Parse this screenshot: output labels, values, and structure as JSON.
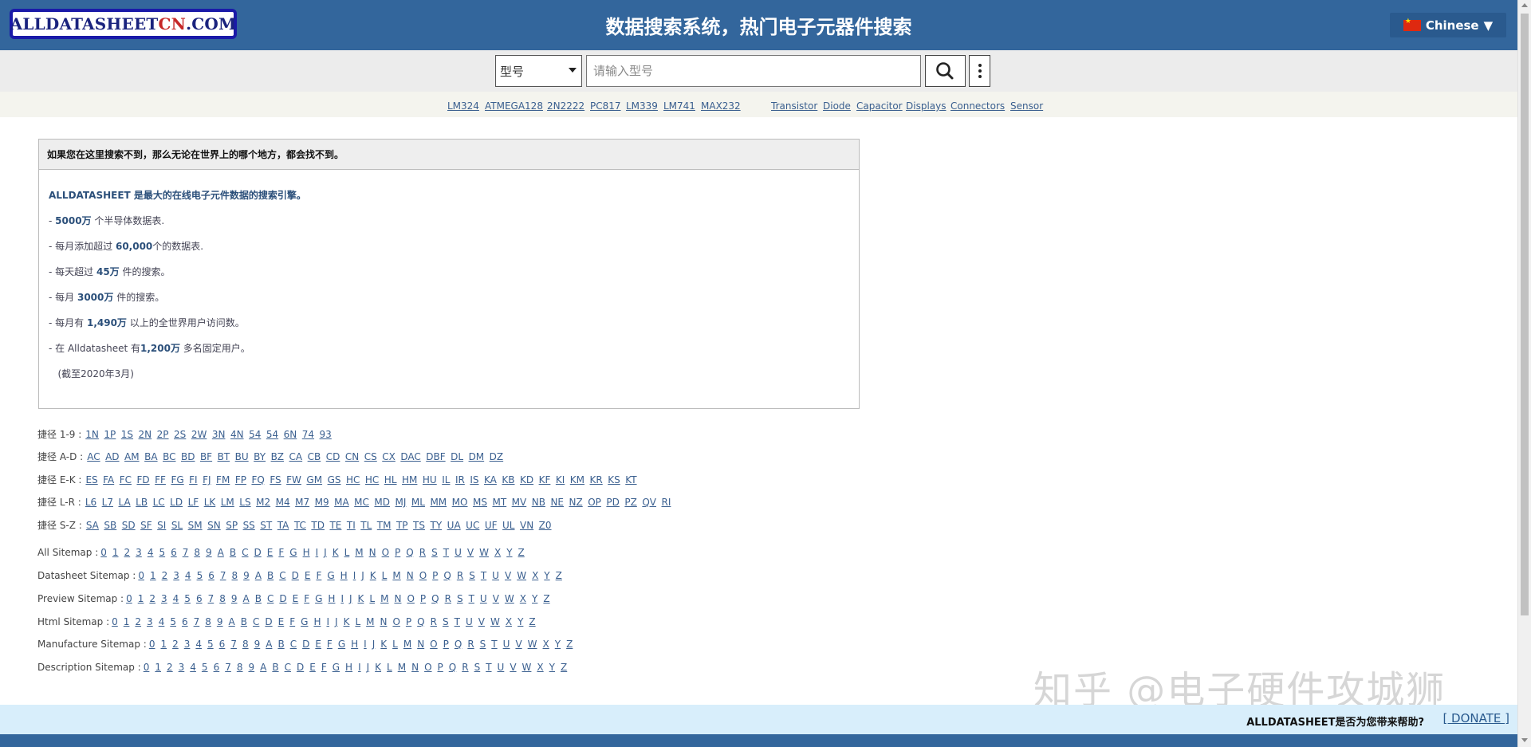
{
  "header": {
    "logo": {
      "part1": "ALLDATASHEET",
      "part2": "CN",
      "part3": ".COM"
    },
    "title": "数据搜索系统，热门电子元器件搜索",
    "language": "Chinese",
    "language_caret": "▼"
  },
  "search": {
    "type_selected": "型号",
    "placeholder": "请输入型号"
  },
  "quick_links": {
    "parts": [
      "LM324",
      "ATMEGA128",
      "2N2222",
      "PC817",
      "LM339",
      "LM741",
      "MAX232"
    ],
    "categories": [
      "Transistor",
      "Diode",
      "Capacitor",
      "Displays",
      "Connectors",
      "Sensor"
    ]
  },
  "info_box": {
    "header": "如果您在这里搜索不到，那么无论在世界上的哪个地方，都会找不到。",
    "intro_bold": "ALLDATASHEET",
    "intro_rest": " 是最大的在线电子元件数据的搜索引擎。",
    "lines": [
      {
        "pre": " - ",
        "bold": "5000万",
        "post": " 个半导体数据表."
      },
      {
        "pre": " - 每月添加超过 ",
        "bold": "60,000",
        "post": "个的数据表."
      },
      {
        "pre": " - 每天超过 ",
        "bold": "45万",
        "post": " 件的搜索。"
      },
      {
        "pre": " - 每月 ",
        "bold": "3000万",
        "post": " 件的搜索。"
      },
      {
        "pre": " - 每月有 ",
        "bold": "1,490万",
        "post": " 以上的全世界用户访问数。"
      },
      {
        "pre": " - 在 Alldatasheet 有",
        "bold": "1,200万",
        "post": " 多名固定用户。"
      }
    ],
    "note": "   (截至2020年3月)"
  },
  "shortcut_rows": [
    {
      "label": "捷径 1-9 :",
      "links": [
        "1N",
        "1P",
        "1S",
        "2N",
        "2P",
        "2S",
        "2W",
        "3N",
        "4N",
        "54",
        "54",
        "6N",
        "74",
        "93"
      ]
    },
    {
      "label": "捷径 A-D :",
      "links": [
        "AC",
        "AD",
        "AM",
        "BA",
        "BC",
        "BD",
        "BF",
        "BT",
        "BU",
        "BY",
        "BZ",
        "CA",
        "CB",
        "CD",
        "CN",
        "CS",
        "CX",
        "DAC",
        "DBF",
        "DL",
        "DM",
        "DZ"
      ]
    },
    {
      "label": "捷径 E-K :",
      "links": [
        "ES",
        "FA",
        "FC",
        "FD",
        "FF",
        "FG",
        "FI",
        "FJ",
        "FM",
        "FP",
        "FQ",
        "FS",
        "FW",
        "GM",
        "GS",
        "HC",
        "HC",
        "HL",
        "HM",
        "HU",
        "IL",
        "IR",
        "IS",
        "KA",
        "KB",
        "KD",
        "KF",
        "KI",
        "KM",
        "KR",
        "KS",
        "KT"
      ]
    },
    {
      "label": "捷径 L-R :",
      "links": [
        "L6",
        "L7",
        "LA",
        "LB",
        "LC",
        "LD",
        "LF",
        "LK",
        "LM",
        "LS",
        "M2",
        "M4",
        "M7",
        "M9",
        "MA",
        "MC",
        "MD",
        "MJ",
        "ML",
        "MM",
        "MO",
        "MS",
        "MT",
        "MV",
        "NB",
        "NE",
        "NZ",
        "OP",
        "PD",
        "PZ",
        "QV",
        "RI"
      ]
    },
    {
      "label": "捷径 S-Z :",
      "links": [
        "SA",
        "SB",
        "SD",
        "SF",
        "SI",
        "SL",
        "SM",
        "SN",
        "SP",
        "SS",
        "ST",
        "TA",
        "TC",
        "TD",
        "TE",
        "TI",
        "TL",
        "TM",
        "TP",
        "TS",
        "TY",
        "UA",
        "UC",
        "UF",
        "UL",
        "VN",
        "Z0"
      ]
    }
  ],
  "sitemap_rows": [
    {
      "label": "All Sitemap :",
      "links": [
        "0",
        "1",
        "2",
        "3",
        "4",
        "5",
        "6",
        "7",
        "8",
        "9",
        "A",
        "B",
        "C",
        "D",
        "E",
        "F",
        "G",
        "H",
        "I",
        "J",
        "K",
        "L",
        "M",
        "N",
        "O",
        "P",
        "Q",
        "R",
        "S",
        "T",
        "U",
        "V",
        "W",
        "X",
        "Y",
        "Z"
      ]
    },
    {
      "label": "Datasheet Sitemap :",
      "links": [
        "0",
        "1",
        "2",
        "3",
        "4",
        "5",
        "6",
        "7",
        "8",
        "9",
        "A",
        "B",
        "C",
        "D",
        "E",
        "F",
        "G",
        "H",
        "I",
        "J",
        "K",
        "L",
        "M",
        "N",
        "O",
        "P",
        "Q",
        "R",
        "S",
        "T",
        "U",
        "V",
        "W",
        "X",
        "Y",
        "Z"
      ]
    },
    {
      "label": "Preview Sitemap :",
      "links": [
        "0",
        "1",
        "2",
        "3",
        "4",
        "5",
        "6",
        "7",
        "8",
        "9",
        "A",
        "B",
        "C",
        "D",
        "E",
        "F",
        "G",
        "H",
        "I",
        "J",
        "K",
        "L",
        "M",
        "N",
        "O",
        "P",
        "Q",
        "R",
        "S",
        "T",
        "U",
        "V",
        "W",
        "X",
        "Y",
        "Z"
      ]
    },
    {
      "label": "Html Sitemap :",
      "links": [
        "0",
        "1",
        "2",
        "3",
        "4",
        "5",
        "6",
        "7",
        "8",
        "9",
        "A",
        "B",
        "C",
        "D",
        "E",
        "F",
        "G",
        "H",
        "I",
        "J",
        "K",
        "L",
        "M",
        "N",
        "O",
        "P",
        "Q",
        "R",
        "S",
        "T",
        "U",
        "V",
        "W",
        "X",
        "Y",
        "Z"
      ]
    },
    {
      "label": "Manufacture Sitemap :",
      "links": [
        "0",
        "1",
        "2",
        "3",
        "4",
        "5",
        "6",
        "7",
        "8",
        "9",
        "A",
        "B",
        "C",
        "D",
        "E",
        "F",
        "G",
        "H",
        "I",
        "J",
        "K",
        "L",
        "M",
        "N",
        "O",
        "P",
        "Q",
        "R",
        "S",
        "T",
        "U",
        "V",
        "W",
        "X",
        "Y",
        "Z"
      ]
    },
    {
      "label": "Description Sitemap :",
      "links": [
        "0",
        "1",
        "2",
        "3",
        "4",
        "5",
        "6",
        "7",
        "8",
        "9",
        "A",
        "B",
        "C",
        "D",
        "E",
        "F",
        "G",
        "H",
        "I",
        "J",
        "K",
        "L",
        "M",
        "N",
        "O",
        "P",
        "Q",
        "R",
        "S",
        "T",
        "U",
        "V",
        "W",
        "X",
        "Y",
        "Z"
      ]
    }
  ],
  "watermark": "知乎 @电子硬件攻城狮",
  "footer": {
    "question": "ALLDATASHEET是否为您带来帮助?",
    "donate": "[ DONATE ]"
  },
  "colors": {
    "header_bg": "#33669c",
    "link": "#3a5f8f",
    "footer_bg": "#d8eefb"
  },
  "icons": {
    "search": "magnifier-icon",
    "more": "vertical-dots-icon",
    "flag": "china-flag-icon"
  }
}
